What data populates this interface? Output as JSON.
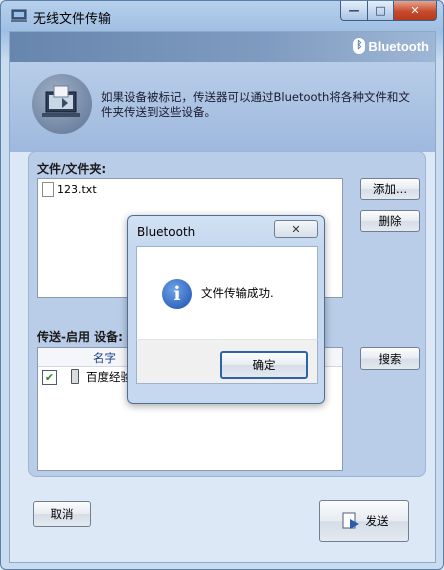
{
  "window": {
    "title": "无线文件传输",
    "controls": {
      "minimize": "—",
      "maximize": "□",
      "close": "✕"
    }
  },
  "banner": {
    "brand": "Bluetooth"
  },
  "header": {
    "description": "如果设备被标记，传送器可以通过Bluetooth将各种文件和文件夹传送到这些设备。"
  },
  "files": {
    "label": "文件/文件夹:",
    "items": [
      "123.txt"
    ],
    "add_button": "添加...",
    "delete_button": "删除"
  },
  "devices": {
    "label": "传送-启用 设备:",
    "column_name": "名字",
    "items": [
      {
        "name": "百度经验",
        "checked": true
      }
    ],
    "search_button": "搜索"
  },
  "footer": {
    "cancel_button": "取消",
    "send_button": "发送"
  },
  "dialog": {
    "title": "Bluetooth",
    "close": "✕",
    "message": "文件传输成功.",
    "ok_button": "确定"
  }
}
